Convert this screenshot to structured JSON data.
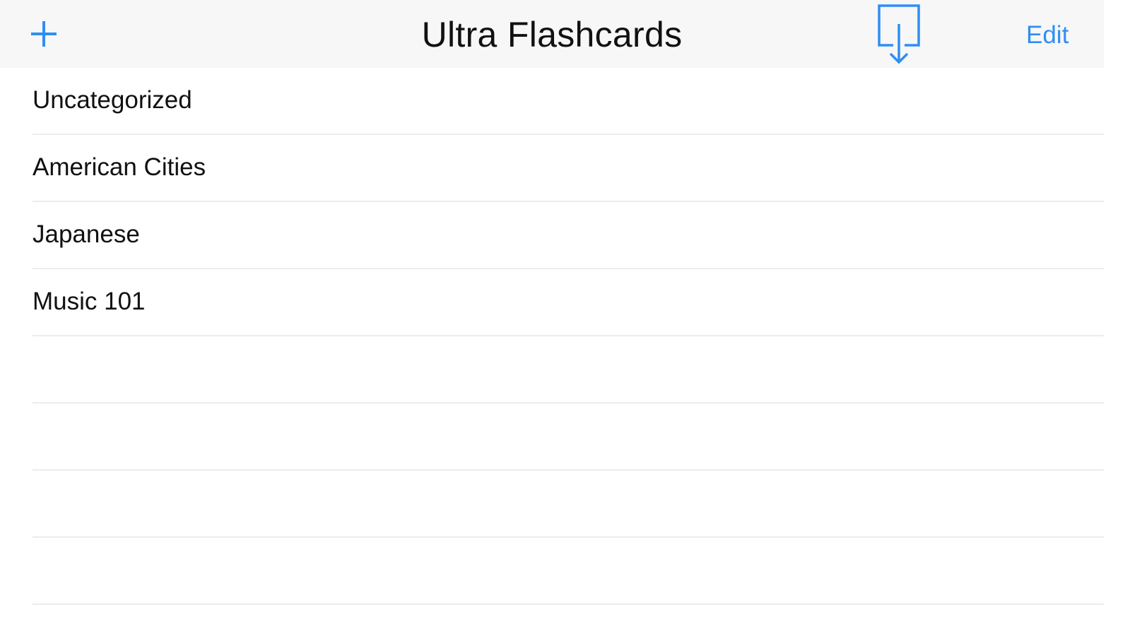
{
  "navbar": {
    "title": "Ultra Flashcards",
    "add_icon": "plus-icon",
    "import_icon": "import-download-icon",
    "edit_label": "Edit",
    "accent_color": "#2f8ef4"
  },
  "decks": [
    {
      "label": "Uncategorized"
    },
    {
      "label": "American Cities"
    },
    {
      "label": "Japanese"
    },
    {
      "label": "Music 101"
    },
    {
      "label": ""
    },
    {
      "label": ""
    },
    {
      "label": ""
    },
    {
      "label": ""
    }
  ]
}
